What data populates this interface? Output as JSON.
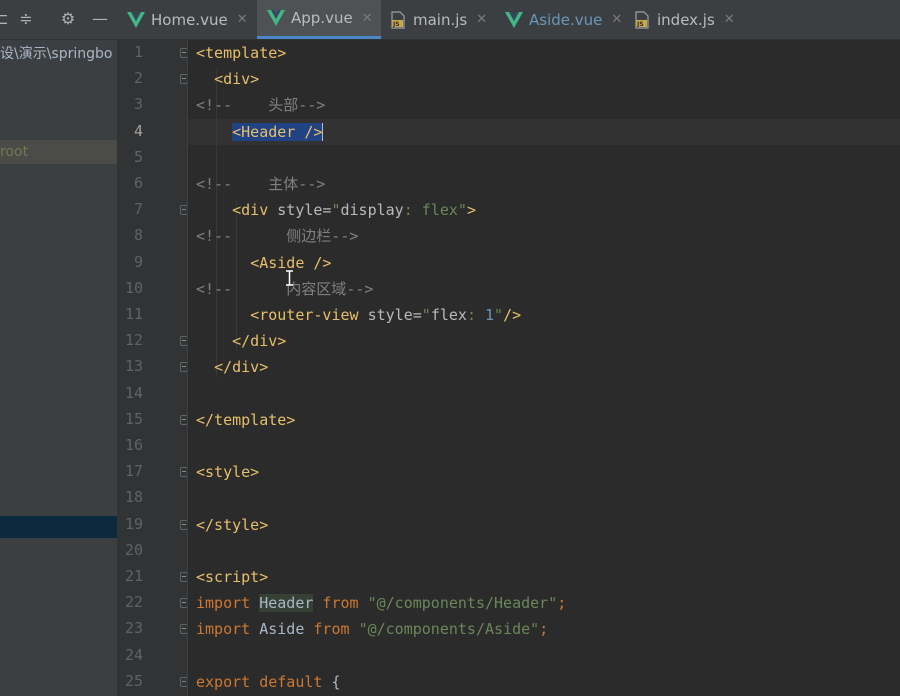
{
  "project": {
    "path_text": "设\\演示\\springbo",
    "root_label": "root"
  },
  "tabs": [
    {
      "label": "Home.vue",
      "type": "vue",
      "active": false,
      "color": "#bbbbbb"
    },
    {
      "label": "App.vue",
      "type": "vue",
      "active": true,
      "color": "#bbbbbb"
    },
    {
      "label": "main.js",
      "type": "js",
      "active": false,
      "color": "#bbbbbb"
    },
    {
      "label": "Aside.vue",
      "type": "vue",
      "active": false,
      "color": "#6897bb"
    },
    {
      "label": "index.js",
      "type": "js",
      "active": false,
      "color": "#bbbbbb"
    }
  ],
  "icons": {
    "vue": "vue-file-icon",
    "js": "js-file-icon",
    "close": "close-icon",
    "settings": "gear-icon",
    "minimize": "minus-icon",
    "collapse": "collapse-icon",
    "expand": "expand-icon"
  },
  "colors": {
    "background": "#2b2b2b",
    "tag": "#e8bf6a",
    "comment": "#808080",
    "string": "#6a8759",
    "keyword": "#cc7832",
    "number": "#6897bb",
    "selection": "#214283",
    "active_tab_underline": "#4a88c7"
  },
  "editor": {
    "current_line": 4,
    "lines": [
      {
        "n": "1",
        "fold": true,
        "tokens": [
          {
            "t": "<template>",
            "c": "tag"
          }
        ]
      },
      {
        "n": "2",
        "fold": true,
        "tokens": [
          {
            "t": "  ",
            "c": "plain"
          },
          {
            "t": "<div>",
            "c": "tag"
          }
        ]
      },
      {
        "n": "3",
        "fold": false,
        "tokens": [
          {
            "t": "<!--    头部-->",
            "c": "comment"
          }
        ]
      },
      {
        "n": "4",
        "fold": false,
        "tokens": [
          {
            "t": "    ",
            "c": "plain"
          },
          {
            "t": "<Header />",
            "c": "tag",
            "sel": true
          },
          {
            "t": "",
            "c": "caret"
          }
        ]
      },
      {
        "n": "5",
        "fold": false,
        "tokens": []
      },
      {
        "n": "6",
        "fold": false,
        "tokens": [
          {
            "t": "<!--    主体-->",
            "c": "comment"
          }
        ]
      },
      {
        "n": "7",
        "fold": true,
        "tokens": [
          {
            "t": "    ",
            "c": "plain"
          },
          {
            "t": "<div ",
            "c": "tag"
          },
          {
            "t": "style=",
            "c": "attr"
          },
          {
            "t": "\"",
            "c": "str"
          },
          {
            "t": "display",
            "c": "attr"
          },
          {
            "t": ": ",
            "c": "str"
          },
          {
            "t": "flex",
            "c": "str"
          },
          {
            "t": "\"",
            "c": "str"
          },
          {
            "t": ">",
            "c": "tag"
          }
        ]
      },
      {
        "n": "8",
        "fold": false,
        "tokens": [
          {
            "t": "<!--      侧边栏-->",
            "c": "comment"
          }
        ]
      },
      {
        "n": "9",
        "fold": false,
        "tokens": [
          {
            "t": "      ",
            "c": "plain"
          },
          {
            "t": "<Aside />",
            "c": "tag"
          }
        ]
      },
      {
        "n": "10",
        "fold": false,
        "tokens": [
          {
            "t": "<!--      内容区域-->",
            "c": "comment"
          }
        ]
      },
      {
        "n": "11",
        "fold": false,
        "tokens": [
          {
            "t": "      ",
            "c": "plain"
          },
          {
            "t": "<router-view ",
            "c": "tag"
          },
          {
            "t": "style=",
            "c": "attr"
          },
          {
            "t": "\"",
            "c": "str"
          },
          {
            "t": "flex",
            "c": "attr"
          },
          {
            "t": ": ",
            "c": "str"
          },
          {
            "t": "1",
            "c": "num"
          },
          {
            "t": "\"",
            "c": "str"
          },
          {
            "t": "/>",
            "c": "tag"
          }
        ]
      },
      {
        "n": "12",
        "fold": true,
        "tokens": [
          {
            "t": "    ",
            "c": "plain"
          },
          {
            "t": "</div>",
            "c": "tag"
          }
        ]
      },
      {
        "n": "13",
        "fold": true,
        "tokens": [
          {
            "t": "  ",
            "c": "plain"
          },
          {
            "t": "</div>",
            "c": "tag"
          }
        ]
      },
      {
        "n": "14",
        "fold": false,
        "tokens": []
      },
      {
        "n": "15",
        "fold": true,
        "tokens": [
          {
            "t": "</template>",
            "c": "tag"
          }
        ]
      },
      {
        "n": "16",
        "fold": false,
        "tokens": []
      },
      {
        "n": "17",
        "fold": true,
        "tokens": [
          {
            "t": "<style>",
            "c": "tag"
          }
        ]
      },
      {
        "n": "18",
        "fold": false,
        "tokens": []
      },
      {
        "n": "19",
        "fold": true,
        "tokens": [
          {
            "t": "</style>",
            "c": "tag"
          }
        ]
      },
      {
        "n": "20",
        "fold": false,
        "tokens": []
      },
      {
        "n": "21",
        "fold": true,
        "tokens": [
          {
            "t": "<script>",
            "c": "tag"
          }
        ]
      },
      {
        "n": "22",
        "fold": true,
        "tokens": [
          {
            "t": "import ",
            "c": "kw"
          },
          {
            "t": "Header",
            "c": "plain",
            "hl": true
          },
          {
            "t": " from ",
            "c": "kw"
          },
          {
            "t": "\"@/components/Header\"",
            "c": "str"
          },
          {
            "t": ";",
            "c": "kw"
          }
        ]
      },
      {
        "n": "23",
        "fold": true,
        "tokens": [
          {
            "t": "import ",
            "c": "kw"
          },
          {
            "t": "Aside",
            "c": "plain"
          },
          {
            "t": " from ",
            "c": "kw"
          },
          {
            "t": "\"@/components/Aside\"",
            "c": "str"
          },
          {
            "t": ";",
            "c": "kw"
          }
        ]
      },
      {
        "n": "24",
        "fold": false,
        "tokens": []
      },
      {
        "n": "25",
        "fold": true,
        "tokens": [
          {
            "t": "export default ",
            "c": "kw"
          },
          {
            "t": "{",
            "c": "plain"
          }
        ]
      }
    ]
  }
}
